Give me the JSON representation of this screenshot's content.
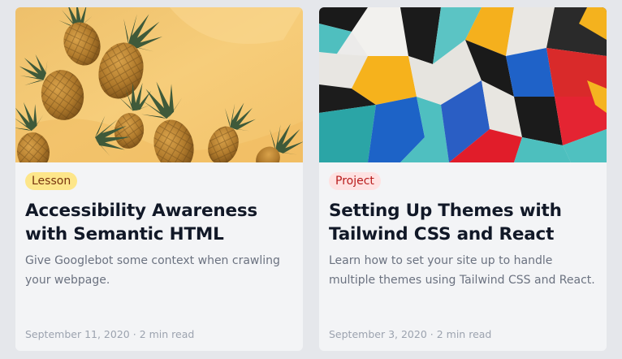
{
  "cards": [
    {
      "image": "pineapples-on-yellow",
      "badge": "Lesson",
      "title": "Accessibility Awareness with Semantic HTML",
      "description": "Give Googlebot some context when crawling your webpage.",
      "date": "September 11, 2020",
      "separator": "·",
      "read_time": "2 min read"
    },
    {
      "image": "colorful-abstract-mural",
      "badge": "Project",
      "title": "Setting Up Themes with Tailwind CSS and React",
      "description": "Learn how to set your site up to handle multiple themes using Tailwind CSS and React.",
      "date": "September 3, 2020",
      "separator": "·",
      "read_time": "2 min read"
    }
  ],
  "colors": {
    "page_bg": "#e5e7eb",
    "card_bg": "#f3f4f6",
    "lesson_badge_bg": "#fde68a",
    "lesson_badge_text": "#78350f",
    "project_badge_bg": "#fee2e2",
    "project_badge_text": "#b91c1c"
  }
}
